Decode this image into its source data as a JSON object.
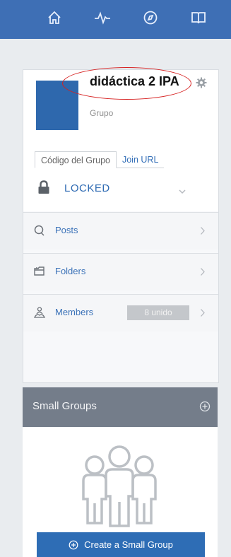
{
  "topbar": {
    "icons": [
      "home-icon",
      "activity-icon",
      "compass-icon",
      "book-icon"
    ]
  },
  "group": {
    "name": "didáctica 2 IPA",
    "type": "Grupo"
  },
  "tabs": {
    "code": "Código del Grupo",
    "join": "Join URL"
  },
  "lock": {
    "status": "LOCKED"
  },
  "nav": {
    "posts": "Posts",
    "folders": "Folders",
    "members": "Members",
    "members_badge": "8 unido"
  },
  "small_groups": {
    "title": "Small Groups",
    "create_label": "Create a Small Group"
  },
  "colors": {
    "topbar": "#3e6fb5",
    "avatar": "#2e68ad",
    "link": "#3570b8",
    "small_groups_header": "#747d8a",
    "annotation": "#d62020"
  }
}
